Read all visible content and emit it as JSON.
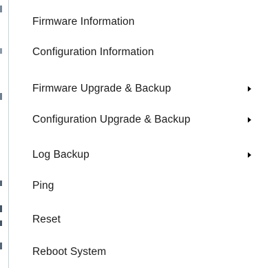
{
  "menu": {
    "items": [
      {
        "label": "Firmware Information",
        "has_submenu": false
      },
      {
        "label": "Configuration Information",
        "has_submenu": false
      },
      {
        "label": "Firmware Upgrade & Backup",
        "has_submenu": true,
        "submenu_icon": "triangle-right-icon"
      },
      {
        "label": "Configuration Upgrade & Backup",
        "has_submenu": true,
        "submenu_icon": "triangle-right-icon"
      },
      {
        "label": "Log Backup",
        "has_submenu": true,
        "submenu_icon": "triangle-right-icon"
      },
      {
        "label": "Ping",
        "has_submenu": false
      },
      {
        "label": "Reset",
        "has_submenu": false
      },
      {
        "label": "Reboot System",
        "has_submenu": false
      }
    ]
  },
  "colors": {
    "text": "#1a1a1a",
    "background": "#ffffff",
    "arrow": "#000000"
  }
}
